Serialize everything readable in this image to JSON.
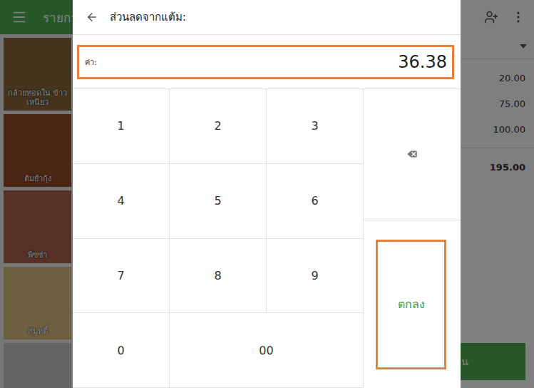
{
  "app": {
    "title": "รายการ",
    "charge_button": "น"
  },
  "products": [
    {
      "label": "กล้วยทอดใน ข้าวเหนียว",
      "color": "#8a6a3a"
    },
    {
      "label": "ต้มยำกุ้ง",
      "color": "#9a4a2a"
    },
    {
      "label": "พิซซ่า",
      "color": "#b0604a"
    },
    {
      "label": "สมูทตี้",
      "color": "#d8c080"
    },
    {
      "label": "",
      "color": "#c8c8c8"
    }
  ],
  "ticket": {
    "lines": [
      "20.00",
      "75.00",
      "100.00"
    ],
    "total": "195.00"
  },
  "dialog": {
    "title": "ส่วนลดจากแต้ม:",
    "field": {
      "label": "ค่า:",
      "value": "36.38",
      "highlighted": true
    },
    "digits": [
      "1",
      "2",
      "3",
      "4",
      "5",
      "6",
      "7",
      "8",
      "9",
      "0",
      "00"
    ],
    "ok": {
      "label": "ตกลง",
      "highlighted": true
    }
  }
}
